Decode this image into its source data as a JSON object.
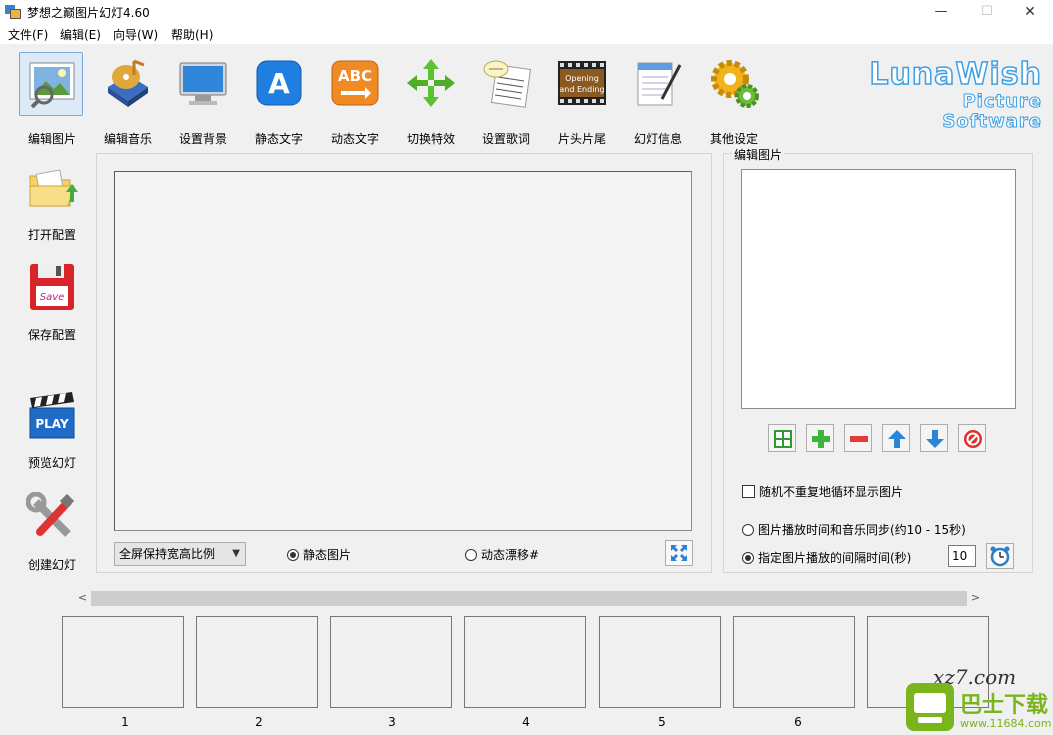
{
  "window": {
    "title": "梦想之巅图片幻灯4.60",
    "min": "—",
    "max": "☐",
    "close": "✕"
  },
  "menu": [
    "文件(F)",
    "编辑(E)",
    "向导(W)",
    "帮助(H)"
  ],
  "toolbar": [
    {
      "label": "编辑图片",
      "icon": "picture-icon"
    },
    {
      "label": "编辑音乐",
      "icon": "music-cd-icon"
    },
    {
      "label": "设置背景",
      "icon": "monitor-icon"
    },
    {
      "label": "静态文字",
      "icon": "letter-a-icon"
    },
    {
      "label": "动态文字",
      "icon": "abc-arrow-icon"
    },
    {
      "label": "切换特效",
      "icon": "four-arrows-icon"
    },
    {
      "label": "设置歌词",
      "icon": "lyrics-icon"
    },
    {
      "label": "片头片尾",
      "icon": "film-icon",
      "icon_text": [
        "Opening",
        "and Ending"
      ]
    },
    {
      "label": "幻灯信息",
      "icon": "notepad-icon"
    },
    {
      "label": "其他设定",
      "icon": "gears-icon"
    }
  ],
  "brand": {
    "line1": "LunaWish",
    "line2": "Picture Software"
  },
  "side_tools": [
    {
      "label": "打开配置",
      "icon": "open-folder-icon"
    },
    {
      "label": "保存配置",
      "icon": "save-disk-icon",
      "icon_text": "Save"
    },
    {
      "label": "预览幻灯",
      "icon": "clapper-play-icon",
      "icon_text": "PLAY"
    },
    {
      "label": "创建幻灯",
      "icon": "tools-icon"
    }
  ],
  "main": {
    "scale_mode": "全屏保持宽高比例",
    "static_label": "静态图片",
    "dynamic_label": "动态漂移#",
    "static_selected": true
  },
  "right": {
    "title": "编辑图片",
    "random_label": "随机不重复地循环显示图片",
    "sync_label": "图片播放时间和音乐同步(约10 - 15秒)",
    "interval_label": "指定图片播放的间隔时间(秒)",
    "interval_value": "10",
    "random_checked": false,
    "interval_selected": true
  },
  "thumbnails": [
    "1",
    "2",
    "3",
    "4",
    "5",
    "6"
  ],
  "watermark": {
    "top": "xz7.com",
    "brand": "巴士下载",
    "url": "www.11684.com"
  },
  "colors": {
    "accent": "#3d9fe4",
    "panel": "#f0f0f0",
    "watermark_green": "#7bb51c"
  }
}
